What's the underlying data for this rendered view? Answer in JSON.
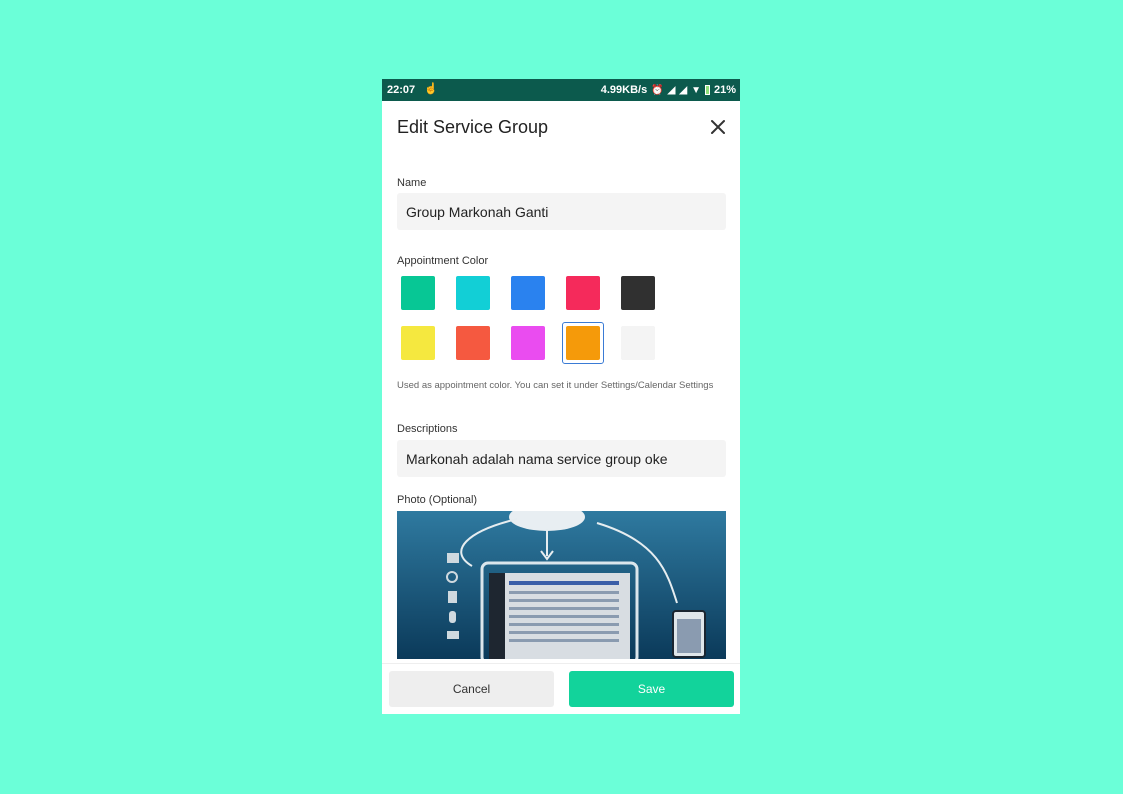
{
  "colors": {
    "background": "#6bffd8",
    "status_bar": "#0c5a4d",
    "accent_save": "#12d39b",
    "selected_ring": "#3a7bd5"
  },
  "status_bar": {
    "time": "22:07",
    "network_speed": "4.99KB/s",
    "battery": "21%",
    "icons": [
      "touch-icon",
      "alarm-icon",
      "signal-icon",
      "signal-icon",
      "wifi-icon",
      "battery-icon"
    ]
  },
  "dialog": {
    "title": "Edit Service Group",
    "close_icon": "close-icon"
  },
  "form": {
    "name_label": "Name",
    "name_value": "Group Markonah Ganti",
    "color_label": "Appointment Color",
    "colors": [
      {
        "hex": "#07c795",
        "selected": false
      },
      {
        "hex": "#12cfd6",
        "selected": false
      },
      {
        "hex": "#2a82ef",
        "selected": false
      },
      {
        "hex": "#f52a5b",
        "selected": false
      },
      {
        "hex": "#303030",
        "selected": false
      },
      {
        "hex": "#f5e83f",
        "selected": false
      },
      {
        "hex": "#f55940",
        "selected": false
      },
      {
        "hex": "#ea4cf0",
        "selected": false
      },
      {
        "hex": "#f59a0a",
        "selected": true
      },
      {
        "hex": "#f4f4f4",
        "selected": false
      }
    ],
    "color_hint": "Used as appointment color. You can set it under Settings/Calendar Settings",
    "description_label": "Descriptions",
    "description_value": "Markonah adalah nama service group oke",
    "photo_label": "Photo (Optional)"
  },
  "footer": {
    "cancel_label": "Cancel",
    "save_label": "Save"
  }
}
